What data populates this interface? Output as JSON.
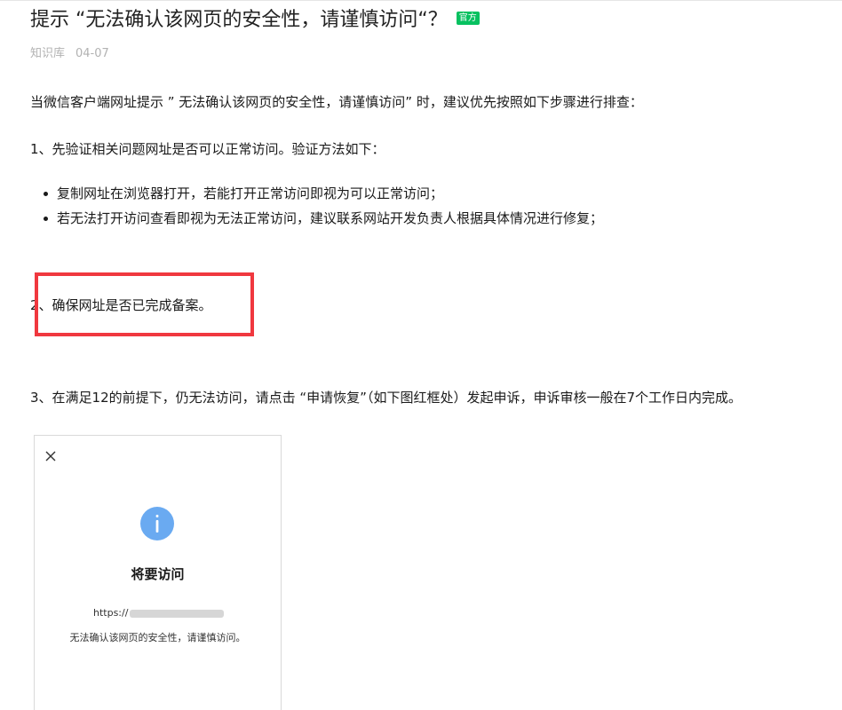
{
  "article": {
    "title": "提示 “无法确认该网页的安全性，请谨慎访问“？",
    "badge": "官方",
    "source": "知识库",
    "date": "04-07"
  },
  "content": {
    "intro": "当微信客户端网址提示 ” 无法确认该网页的安全性，请谨慎访问” 时，建议优先按照如下步骤进行排查：",
    "step1": "1、先验证相关问题网址是否可以正常访问。验证方法如下：",
    "step1_bullets": [
      "复制网址在浏览器打开，若能打开正常访问即视为可以正常访问；",
      "若无法打开访问查看即视为无法正常访问，建议联系网站开发负责人根据具体情况进行修复；"
    ],
    "step2": "2、确保网址是否已完成备案。",
    "step3": "3、在满足12的前提下，仍无法访问，请点击 “申请恢复”（如下图红框处）发起申诉，申诉审核一般在7个工作日内完成。"
  },
  "screenshot": {
    "dialog_title": "将要访问",
    "url_prefix": "https://",
    "warning": "无法确认该网页的安全性，请谨慎访问。"
  },
  "colors": {
    "badge": "#07c160",
    "highlight_border": "#f0383f",
    "info_icon": "#6aaaf1"
  },
  "icons": [
    "close-icon",
    "info-icon"
  ]
}
